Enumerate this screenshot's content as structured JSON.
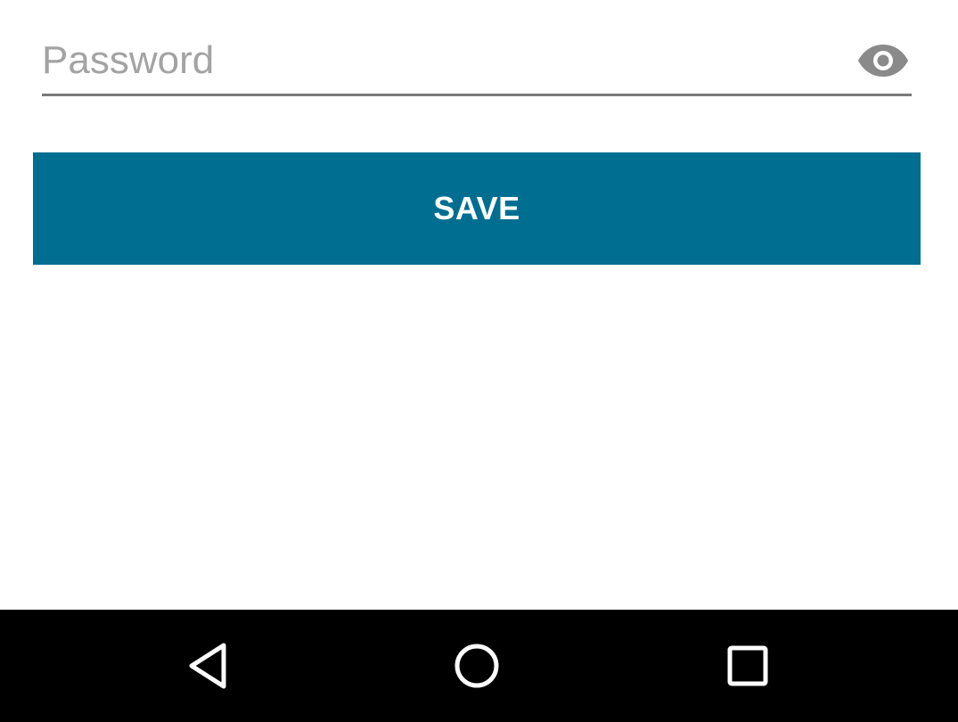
{
  "password_field": {
    "placeholder": "Password",
    "value": "",
    "toggle_icon": "eye-icon"
  },
  "save_button": {
    "label": "SAVE"
  },
  "nav_bar": {
    "items": [
      {
        "icon": "back-icon"
      },
      {
        "icon": "home-icon"
      },
      {
        "icon": "recents-icon"
      }
    ]
  },
  "colors": {
    "accent": "#006e91",
    "field_underline": "#7a7a7a",
    "placeholder": "#a3a3a3",
    "icon_gray": "#8a8a8a",
    "nav_background": "#000000"
  }
}
